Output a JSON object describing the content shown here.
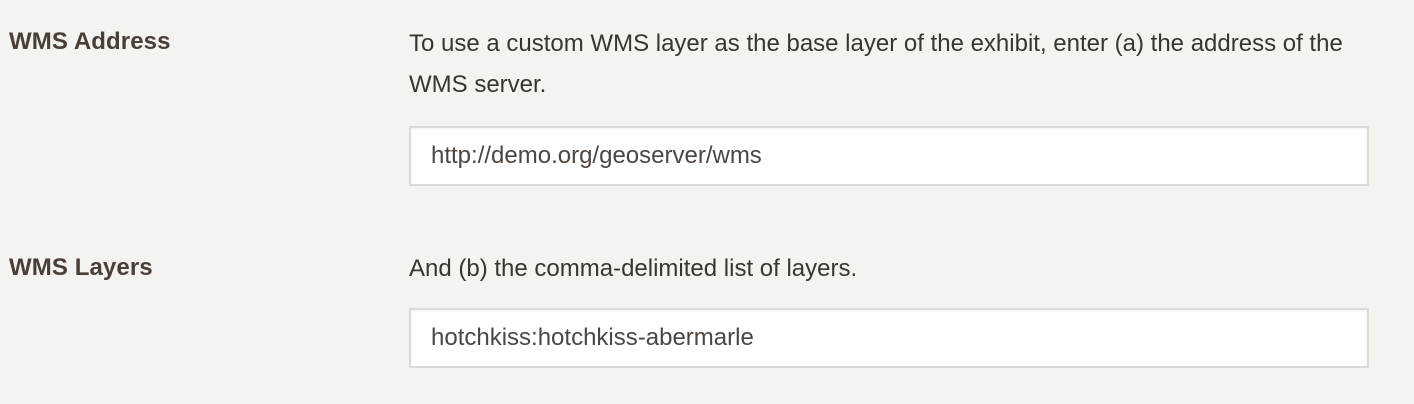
{
  "settings": {
    "wms_address": {
      "label": "WMS Address",
      "description": "To use a custom WMS layer as the base layer of the exhibit, enter (a) the address of the WMS server.",
      "value": "http://demo.org/geoserver/wms"
    },
    "wms_layers": {
      "label": "WMS Layers",
      "description": "And (b) the comma-delimited list of layers.",
      "value": "hotchkiss:hotchkiss-abermarle"
    }
  }
}
